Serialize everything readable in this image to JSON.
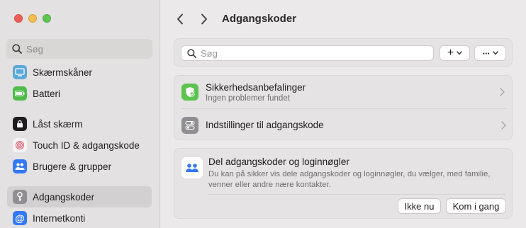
{
  "sidebar": {
    "search_placeholder": "Søg",
    "items": [
      {
        "label": "Skærmskåner",
        "icon": "screensaver-icon",
        "color": "#5aa8d9"
      },
      {
        "label": "Batteri",
        "icon": "battery-icon",
        "color": "#4dbd48"
      },
      {
        "label": "Låst skærm",
        "icon": "lock-screen-icon",
        "color": "#1d1d1f"
      },
      {
        "label": "Touch ID & adgangskode",
        "icon": "fingerprint-icon",
        "color": "#f0f0f0"
      },
      {
        "label": "Brugere & grupper",
        "icon": "users-icon",
        "color": "#3478f6"
      },
      {
        "label": "Adgangskoder",
        "icon": "key-icon",
        "color": "#8e8e93",
        "selected": true
      },
      {
        "label": "Internetkonti",
        "icon": "at-icon",
        "color": "#3478f6"
      }
    ]
  },
  "header": {
    "title": "Adgangskoder"
  },
  "toolbar": {
    "search_placeholder": "Søg",
    "add_label": "+",
    "more_label": "···"
  },
  "security": {
    "title": "Sikkerhedsanbefalinger",
    "subtitle": "Ingen problemer fundet",
    "icon_color": "#5cc351"
  },
  "options": {
    "title": "Indstillinger til adgangskode",
    "icon_color": "#8e8e93"
  },
  "share": {
    "title": "Del adgangskoder og loginnøgler",
    "description": "Du kan på sikker vis dele adgangskoder og loginnøgler, du vælger, med familie, venner eller andre nære kontakter.",
    "not_now_label": "Ikke nu",
    "get_started_label": "Kom i gang",
    "icon_color": "#3478f6"
  }
}
